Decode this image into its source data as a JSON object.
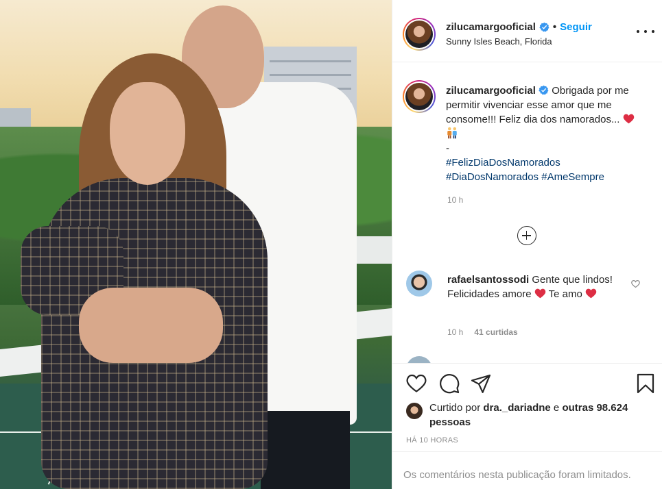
{
  "post": {
    "username": "zilucamargooficial",
    "follow_label": "Seguir",
    "separator": "•",
    "location": "Sunny Isles Beach, Florida",
    "verified": true
  },
  "caption": {
    "username": "zilucamargooficial",
    "text_1": "Obrigada por me permitir vivenciar esse amor que me consome!!! Feliz dia dos namorados...",
    "dash": "-",
    "hashtags": [
      "#FelizDiaDosNamorados",
      "#DiaDosNamorados",
      "#AmeSempre"
    ],
    "emojis": [
      "red-heart",
      "couple"
    ],
    "time": "10 h"
  },
  "comments": [
    {
      "username": "rafaelsantossodi",
      "text_1": "Gente que lindos! Felicidades amore",
      "text_2": "Te amo",
      "time": "10 h",
      "likes": "41 curtidas"
    }
  ],
  "likes": {
    "prefix": "Curtido por",
    "user": "dra._dariadne",
    "conjunction": "e",
    "others": "outras 98.624 pessoas"
  },
  "posted_ago": "HÁ 10 HORAS",
  "comments_limited": "Os comentários nesta publicação foram limitados.",
  "colors": {
    "link_blue": "#0095f6",
    "hashtag_blue": "#00376b",
    "muted": "#8e8e8e",
    "verified_blue": "#3897f0",
    "heart_red": "#ed4956"
  }
}
